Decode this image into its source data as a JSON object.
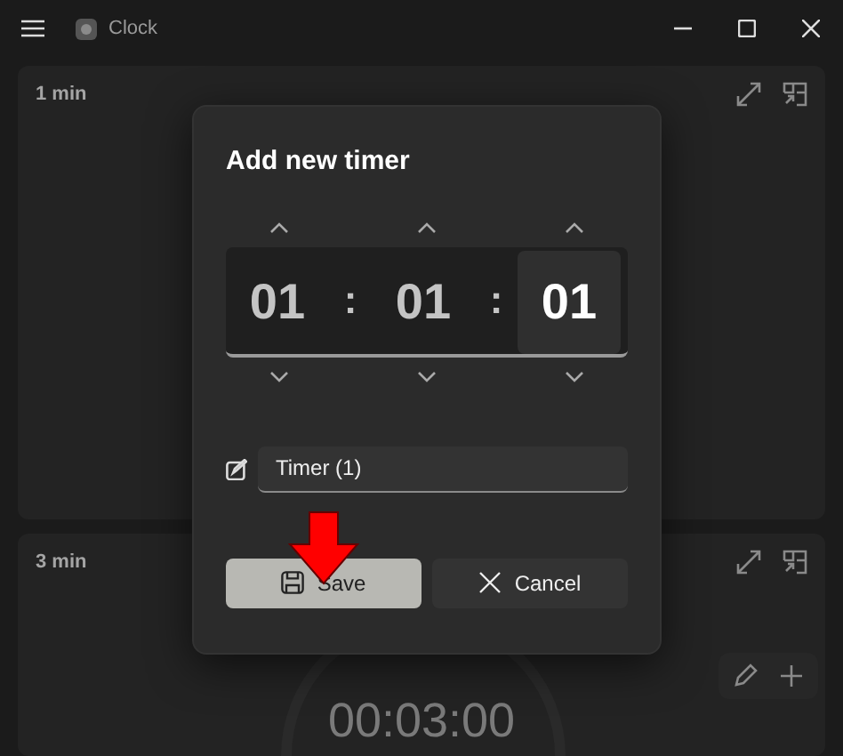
{
  "window": {
    "title": "Clock"
  },
  "timers": [
    {
      "label": "1 min"
    },
    {
      "label": "3 min",
      "display": "00:03:00"
    }
  ],
  "dialog": {
    "title": "Add new timer",
    "segments": [
      {
        "value": "01",
        "selected": false
      },
      {
        "value": "01",
        "selected": false
      },
      {
        "value": "01",
        "selected": true
      }
    ],
    "separators": [
      ":",
      ":"
    ],
    "name_field": {
      "value": "Timer (1)"
    },
    "buttons": [
      {
        "label": "Save",
        "kind": "save"
      },
      {
        "label": "Cancel",
        "kind": "cancel"
      }
    ]
  }
}
